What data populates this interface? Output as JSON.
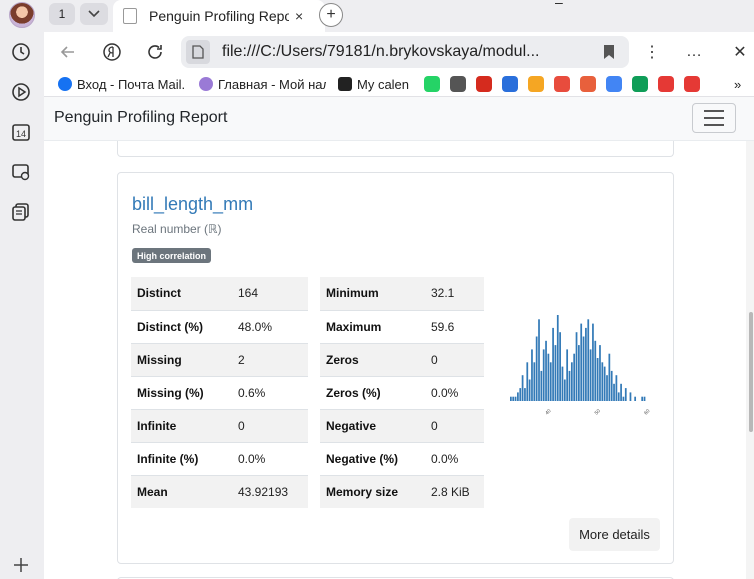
{
  "browser": {
    "tab_count": "1",
    "tab_title": "Penguin Profiling Report",
    "tab_close": "×",
    "new_tab": "+",
    "minimize": "–",
    "more_menu": "⋮",
    "ellipsis": "…",
    "close_window": "✕",
    "url": "file:///C:/Users/79181/n.brykovskaya/modul...",
    "bookmarks": [
      {
        "label": "Вход - Почта Mail.",
        "color": "#1672f2"
      },
      {
        "label": "Главная - Мой нал",
        "color": "#9a7ad6"
      },
      {
        "label": "My calen",
        "color": "#222222"
      }
    ],
    "bookmark_icon_colors": [
      "#25d366",
      "#555555",
      "#d52b1e",
      "#2a6fdb",
      "#f5a623",
      "#e84c3d",
      "#e8603c",
      "#4285f4",
      "#0f9d58",
      "#e53935",
      "#e53935"
    ],
    "more_bookmarks": "»",
    "sidebar_day": "14"
  },
  "page": {
    "brand": "Penguin Profiling Report",
    "variable": {
      "name": "bill_length_mm",
      "type": "Real number (ℝ)",
      "badge": "High correlation",
      "stats_left": [
        {
          "key": "Distinct",
          "value": "164"
        },
        {
          "key": "Distinct (%)",
          "value": "48.0%"
        },
        {
          "key": "Missing",
          "value": "2"
        },
        {
          "key": "Missing (%)",
          "value": "0.6%"
        },
        {
          "key": "Infinite",
          "value": "0"
        },
        {
          "key": "Infinite (%)",
          "value": "0.0%"
        },
        {
          "key": "Mean",
          "value": "43.92193"
        }
      ],
      "stats_right": [
        {
          "key": "Minimum",
          "value": "32.1"
        },
        {
          "key": "Maximum",
          "value": "59.6"
        },
        {
          "key": "Zeros",
          "value": "0"
        },
        {
          "key": "Zeros (%)",
          "value": "0.0%"
        },
        {
          "key": "Negative",
          "value": "0"
        },
        {
          "key": "Negative (%)",
          "value": "0.0%"
        },
        {
          "key": "Memory size",
          "value": "2.8 KiB"
        }
      ],
      "more_details": "More details"
    }
  },
  "histogram": {
    "bar_color": "#337ab7",
    "x_ticks": [
      "40",
      "50",
      "60"
    ],
    "x_range": [
      32.1,
      59.6
    ],
    "bin_counts": [
      1,
      1,
      1,
      2,
      3,
      6,
      3,
      9,
      5,
      12,
      9,
      15,
      19,
      7,
      12,
      14,
      11,
      9,
      17,
      13,
      20,
      16,
      8,
      5,
      12,
      7,
      9,
      11,
      16,
      13,
      18,
      15,
      17,
      19,
      12,
      18,
      14,
      10,
      13,
      9,
      8,
      6,
      11,
      7,
      4,
      6,
      2,
      4,
      1,
      3,
      0,
      2,
      0,
      1,
      0,
      0,
      1,
      1
    ]
  }
}
